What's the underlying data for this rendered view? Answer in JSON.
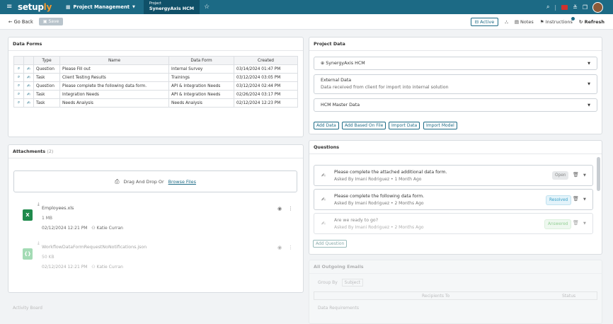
{
  "topbar": {
    "menu_icon": "≡",
    "logo_main": "setup",
    "logo_accent": "ly",
    "section": "Project Management",
    "project_label": "Project",
    "project_name": "SynergyAxis HCM",
    "star_icon": "☆"
  },
  "subbar": {
    "back": "← Go Back",
    "save": "Save",
    "active": "Active",
    "notes": "Notes",
    "instructions": "Instructions",
    "refresh": "Refresh"
  },
  "data_forms": {
    "title": "Data Forms",
    "headers": [
      "Type",
      "Name",
      "Data Form",
      "Created"
    ],
    "rows": [
      {
        "type": "Question",
        "name": "Please Fill out",
        "form": "Internal Survey",
        "created": "03/14/2024 01:47 PM"
      },
      {
        "type": "Task",
        "name": "Client Testing Results",
        "form": "Trainings",
        "created": "03/12/2024 03:05 PM"
      },
      {
        "type": "Question",
        "name": "Please complete the following data form.",
        "form": "API & Integration Needs",
        "created": "03/12/2024 02:44 PM"
      },
      {
        "type": "Task",
        "name": "Integration Needs",
        "form": "API & Integration Needs",
        "created": "02/26/2024 03:17 PM"
      },
      {
        "type": "Task",
        "name": "Needs Analysis",
        "form": "Needs Analysis",
        "created": "02/12/2024 12:23 PM"
      }
    ]
  },
  "attachments": {
    "title": "Attachments",
    "count": "(2)",
    "drop_text": "Drag And Drop Or",
    "browse": "Browse Files",
    "files": [
      {
        "name": "Employees.xls",
        "size": "1 MB",
        "date": "02/12/2024 12:21 PM",
        "user": "Katie Curran",
        "color": "#1f8a4c"
      },
      {
        "name": "WorkflowDataFormRequestNoNotifications.json",
        "size": "50 KB",
        "date": "02/12/2024 12:21 PM",
        "user": "Katie Curran",
        "color": "#5bbf7a"
      }
    ]
  },
  "activity": {
    "title": "Activity Board"
  },
  "project_data": {
    "title": "Project Data",
    "project": "SynergyAxis HCM",
    "external_title": "External Data",
    "external_sub": "Data received from client for import into internal solution",
    "master": "HCM Master Data",
    "buttons": [
      "Add Data",
      "Add Based On File",
      "Import Data",
      "Import Model"
    ]
  },
  "questions": {
    "title": "Questions",
    "items": [
      {
        "text": "Please complete the attached additional data form.",
        "meta": "Asked By Imani Rodriguez • 1 Month Ago",
        "status": "Open",
        "bg": "#e6e8ea",
        "fg": "#888"
      },
      {
        "text": "Please complete the following data form.",
        "meta": "Asked By Imani Rodriguez • 2 Months Ago",
        "status": "Resolved",
        "bg": "#e3f3fa",
        "fg": "#3aa0c8"
      },
      {
        "text": "Are we ready to go?",
        "meta": "Asked By Imani Rodriguez • 2 Months Ago",
        "status": "Answered",
        "bg": "#e4f5e6",
        "fg": "#4caf50"
      }
    ],
    "add": "Add Question"
  },
  "emails": {
    "title": "All Outgoing Emails",
    "group_by": "Group By",
    "subject": "Subject",
    "col_recipients": "Recipients To",
    "col_status": "Status",
    "more": "Data Requirements"
  }
}
